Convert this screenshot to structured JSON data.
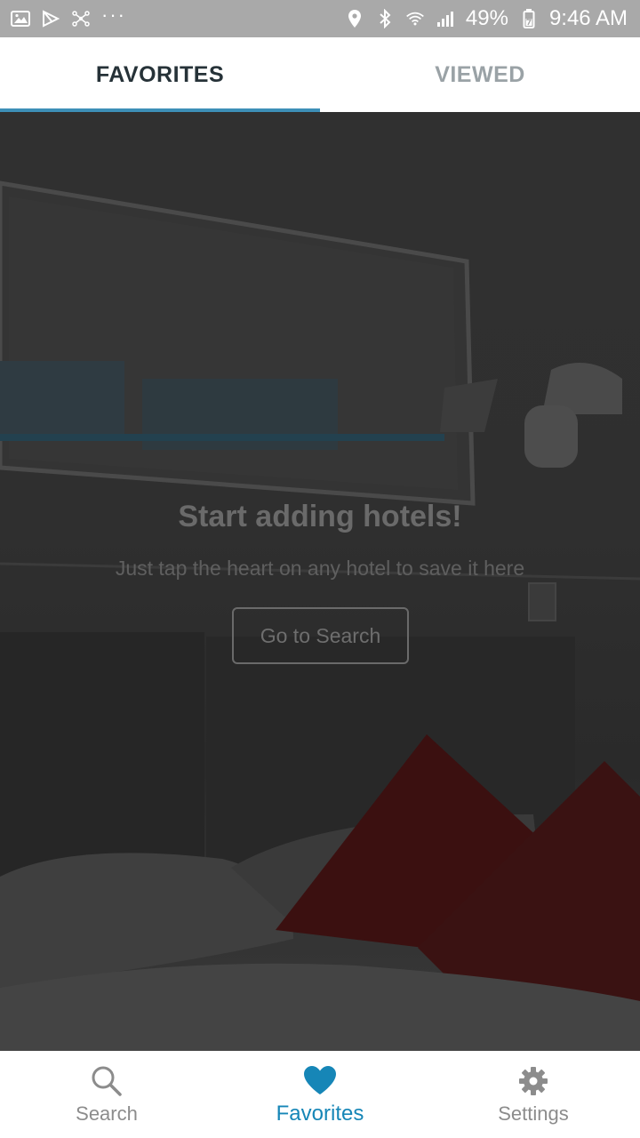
{
  "status_bar": {
    "battery": "49%",
    "time": "9:46 AM",
    "dots": "···",
    "icons_left": [
      "gallery-icon",
      "play-store-icon",
      "network-icon",
      "more-dots"
    ],
    "icons_right": [
      "location-icon",
      "bluetooth-icon",
      "wifi-icon",
      "signal-icon",
      "battery-icon"
    ]
  },
  "tabs": [
    {
      "label": "FAVORITES",
      "active": true
    },
    {
      "label": "VIEWED",
      "active": false
    }
  ],
  "empty_state": {
    "title": "Start adding hotels!",
    "subtitle": "Just tap the heart on any hotel to save it here",
    "button_label": "Go to Search"
  },
  "bottom_nav": [
    {
      "label": "Search",
      "icon": "search-icon",
      "active": false
    },
    {
      "label": "Favorites",
      "icon": "heart-icon",
      "active": true
    },
    {
      "label": "Settings",
      "icon": "gear-icon",
      "active": false
    }
  ],
  "colors": {
    "accent": "#1686b7",
    "tab_indicator": "#3d8fb7",
    "status_bar": "#a9a9a9",
    "overlay": "#2f2f2f"
  }
}
